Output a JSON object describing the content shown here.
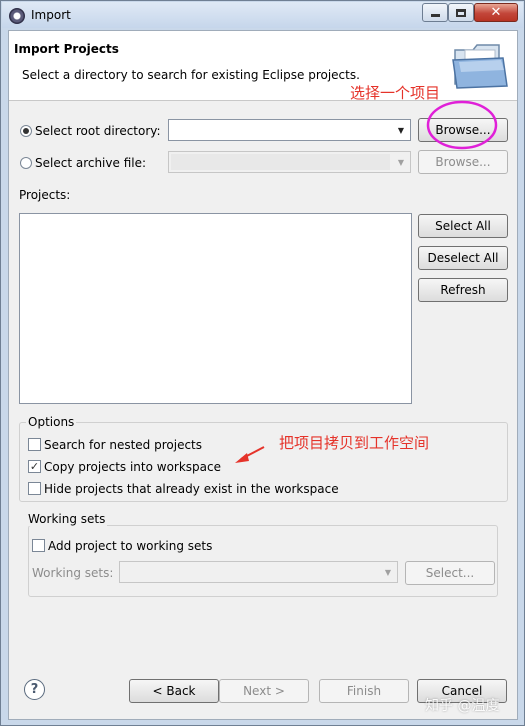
{
  "window": {
    "title": "Import"
  },
  "header": {
    "title": "Import Projects",
    "description": "Select a directory to search for existing Eclipse projects."
  },
  "source": {
    "root_label": "Select root directory:",
    "root_selected": true,
    "root_value": "",
    "archive_label": "Select archive file:",
    "archive_selected": false,
    "browse_label": "Browse...",
    "browse_disabled_label": "Browse..."
  },
  "projects": {
    "label": "Projects:",
    "items": [],
    "select_all": "Select All",
    "deselect_all": "Deselect All",
    "refresh": "Refresh"
  },
  "options": {
    "title": "Options",
    "nested": {
      "label": "Search for nested projects",
      "checked": false
    },
    "copy": {
      "label": "Copy projects into workspace",
      "checked": true
    },
    "hide": {
      "label": "Hide projects that already exist in the workspace",
      "checked": false
    }
  },
  "working_sets": {
    "title": "Working sets",
    "add_label": "Add project to working sets",
    "add_checked": false,
    "sets_label": "Working sets:",
    "select_label": "Select..."
  },
  "footer": {
    "help": "?",
    "back": "< Back",
    "next": "Next >",
    "finish": "Finish",
    "cancel": "Cancel"
  },
  "annotations": {
    "select_project": "选择一个项目",
    "copy_to_workspace": "把项目拷贝到工作空间",
    "annotation_color": "#e5332a",
    "circle_color": "#e020d8"
  },
  "watermark": "知乎 @温度"
}
